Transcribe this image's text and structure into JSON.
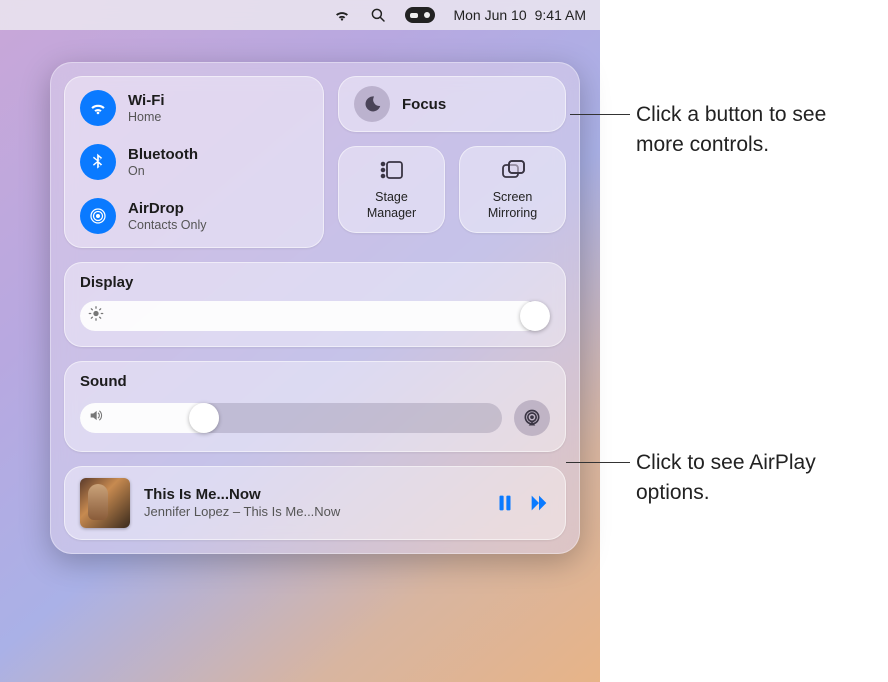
{
  "menubar": {
    "date": "Mon Jun 10",
    "time": "9:41 AM"
  },
  "connectivity": {
    "wifi": {
      "title": "Wi-Fi",
      "status": "Home"
    },
    "bluetooth": {
      "title": "Bluetooth",
      "status": "On"
    },
    "airdrop": {
      "title": "AirDrop",
      "status": "Contacts Only"
    }
  },
  "focus": {
    "title": "Focus"
  },
  "stage": {
    "label": "Stage\nManager"
  },
  "mirroring": {
    "label": "Screen\nMirroring"
  },
  "display": {
    "title": "Display",
    "value_pct": 98
  },
  "sound": {
    "title": "Sound",
    "value_pct": 33
  },
  "now_playing": {
    "title": "This Is Me...Now",
    "subtitle": "Jennifer Lopez – This Is Me...Now"
  },
  "callouts": {
    "focus": "Click a button to see more controls.",
    "airplay": "Click to see AirPlay options."
  },
  "colors": {
    "accent": "#0a7aff"
  }
}
